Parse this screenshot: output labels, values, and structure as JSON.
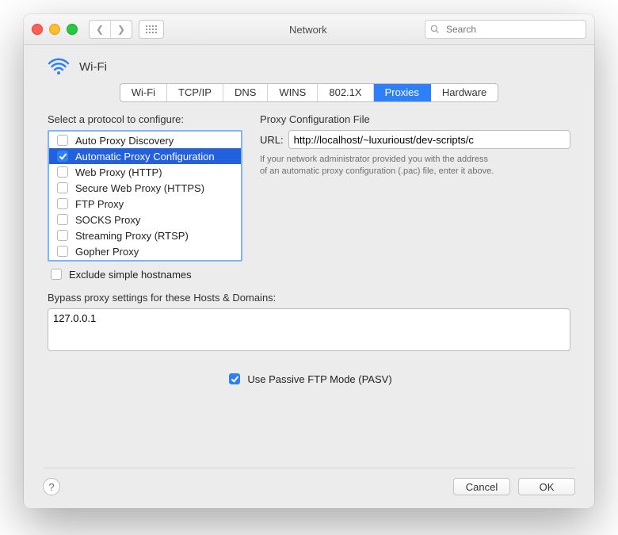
{
  "titlebar": {
    "title": "Network",
    "search_placeholder": "Search"
  },
  "header": {
    "interface": "Wi-Fi"
  },
  "tabs": [
    {
      "label": "Wi-Fi",
      "active": false
    },
    {
      "label": "TCP/IP",
      "active": false
    },
    {
      "label": "DNS",
      "active": false
    },
    {
      "label": "WINS",
      "active": false
    },
    {
      "label": "802.1X",
      "active": false
    },
    {
      "label": "Proxies",
      "active": true
    },
    {
      "label": "Hardware",
      "active": false
    }
  ],
  "left": {
    "title": "Select a protocol to configure:",
    "protocols": [
      {
        "label": "Auto Proxy Discovery",
        "checked": false,
        "selected": false
      },
      {
        "label": "Automatic Proxy Configuration",
        "checked": true,
        "selected": true
      },
      {
        "label": "Web Proxy (HTTP)",
        "checked": false,
        "selected": false
      },
      {
        "label": "Secure Web Proxy (HTTPS)",
        "checked": false,
        "selected": false
      },
      {
        "label": "FTP Proxy",
        "checked": false,
        "selected": false
      },
      {
        "label": "SOCKS Proxy",
        "checked": false,
        "selected": false
      },
      {
        "label": "Streaming Proxy (RTSP)",
        "checked": false,
        "selected": false
      },
      {
        "label": "Gopher Proxy",
        "checked": false,
        "selected": false
      }
    ],
    "exclude_label": "Exclude simple hostnames",
    "exclude_checked": false
  },
  "right": {
    "title": "Proxy Configuration File",
    "url_label": "URL:",
    "url_value": "http://localhost/~luxurioust/dev-scripts/c",
    "help": "If your network administrator provided you with the address of an automatic proxy configuration (.pac) file, enter it above."
  },
  "bypass": {
    "title": "Bypass proxy settings for these Hosts & Domains:",
    "value": "127.0.0.1"
  },
  "pasv": {
    "label": "Use Passive FTP Mode (PASV)",
    "checked": true
  },
  "footer": {
    "cancel": "Cancel",
    "ok": "OK"
  }
}
